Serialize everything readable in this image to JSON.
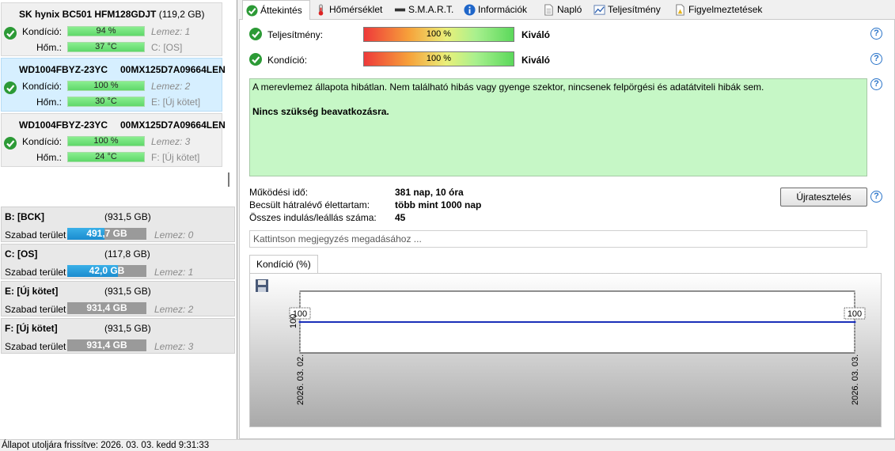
{
  "disks": [
    {
      "title": "SK hynix BC501 HFM128GDJT",
      "capacity": "(119,2 GB)",
      "serial": "",
      "condition_label": "Kondíció:",
      "condition": "94 %",
      "condition_pct": 94,
      "temp_label": "Hőm.:",
      "temp": "37 °C",
      "disk_no": "Lemez: 1",
      "volume": "C: [OS]",
      "selected": false
    },
    {
      "title": "WD1004FBYZ-23YC",
      "capacity": "",
      "serial": "00MX125D7A09664LEN",
      "condition_label": "Kondíció:",
      "condition": "100 %",
      "condition_pct": 100,
      "temp_label": "Hőm.:",
      "temp": "30 °C",
      "disk_no": "Lemez: 2",
      "volume": "E: [Új kötet]",
      "selected": true
    },
    {
      "title": "WD1004FBYZ-23YC",
      "capacity": "",
      "serial": "00MX125D7A09664LEN",
      "condition_label": "Kondíció:",
      "condition": "100 %",
      "condition_pct": 100,
      "temp_label": "Hőm.:",
      "temp": "24 °C",
      "disk_no": "Lemez: 3",
      "volume": "F: [Új kötet]",
      "selected": false
    }
  ],
  "volumes": [
    {
      "name": "B: [BCK]",
      "size": "(931,5 GB)",
      "free_label": "Szabad terület",
      "free": "491,7 GB",
      "used_fraction": 0.47,
      "bar_color": "blue",
      "disk_no": "Lemez: 0"
    },
    {
      "name": "C: [OS]",
      "size": "(117,8 GB)",
      "free_label": "Szabad terület",
      "free": "42,0 GB",
      "used_fraction": 0.64,
      "bar_color": "blue",
      "disk_no": "Lemez: 1"
    },
    {
      "name": "E: [Új kötet]",
      "size": "(931,5 GB)",
      "free_label": "Szabad terület",
      "free": "931,4 GB",
      "used_fraction": 0.0,
      "bar_color": "grey",
      "disk_no": "Lemez: 2"
    },
    {
      "name": "F: [Új kötet]",
      "size": "(931,5 GB)",
      "free_label": "Szabad terület",
      "free": "931,4 GB",
      "used_fraction": 0.0,
      "bar_color": "grey",
      "disk_no": "Lemez: 3"
    }
  ],
  "tabs": [
    {
      "label": "Áttekintés",
      "icon": "check-icon",
      "active": true
    },
    {
      "label": "Hőmérséklet",
      "icon": "thermometer-icon",
      "active": false
    },
    {
      "label": "S.M.A.R.T.",
      "icon": "disk-icon",
      "active": false
    },
    {
      "label": "Információk",
      "icon": "info-icon",
      "active": false
    },
    {
      "label": "Napló",
      "icon": "document-icon",
      "active": false
    },
    {
      "label": "Teljesítmény",
      "icon": "performance-chart-icon",
      "active": false
    },
    {
      "label": "Figyelmeztetések",
      "icon": "warning-document-icon",
      "active": false
    }
  ],
  "overview": {
    "performance_label": "Teljesítmény:",
    "performance_value": "100 %",
    "performance_rating": "Kiváló",
    "condition_label": "Kondíció:",
    "condition_value": "100 %",
    "condition_rating": "Kiváló",
    "message_line1": "A merevlemez állapota hibátlan. Nem található hibás vagy gyenge szektor, nincsenek felpörgési és adatátviteli hibák sem.",
    "message_line2": "Nincs szükség beavatkozásra.",
    "uptime_label": "Működési idő:",
    "uptime_value": "381 nap, 10 óra",
    "lifetime_label": "Becsült hátralévő élettartam:",
    "lifetime_value": "több mint 1000 nap",
    "startstop_label": "Összes indulás/leállás száma:",
    "startstop_value": "45",
    "retest_button": "Újratesztelés",
    "note_placeholder": "Kattintson megjegyzés megadásához ...",
    "help_symbol": "?"
  },
  "chart_tab": "Kondíció  (%)",
  "chart_data": {
    "type": "line",
    "x": [
      "2026. 03. 02.",
      "2026. 03. 03."
    ],
    "series": [
      {
        "values": [
          100,
          100
        ]
      }
    ],
    "data_labels": [
      "100",
      "100"
    ],
    "ytick": "100",
    "color": "#1a2fb8"
  },
  "status_bar": "Állapot utoljára frissítve: 2026. 03. 03. kedd 9:31:33",
  "colors": {
    "ok_green": "#2c9a36",
    "help_blue": "#2a74c9",
    "message_bg": "#c6f7c6"
  }
}
